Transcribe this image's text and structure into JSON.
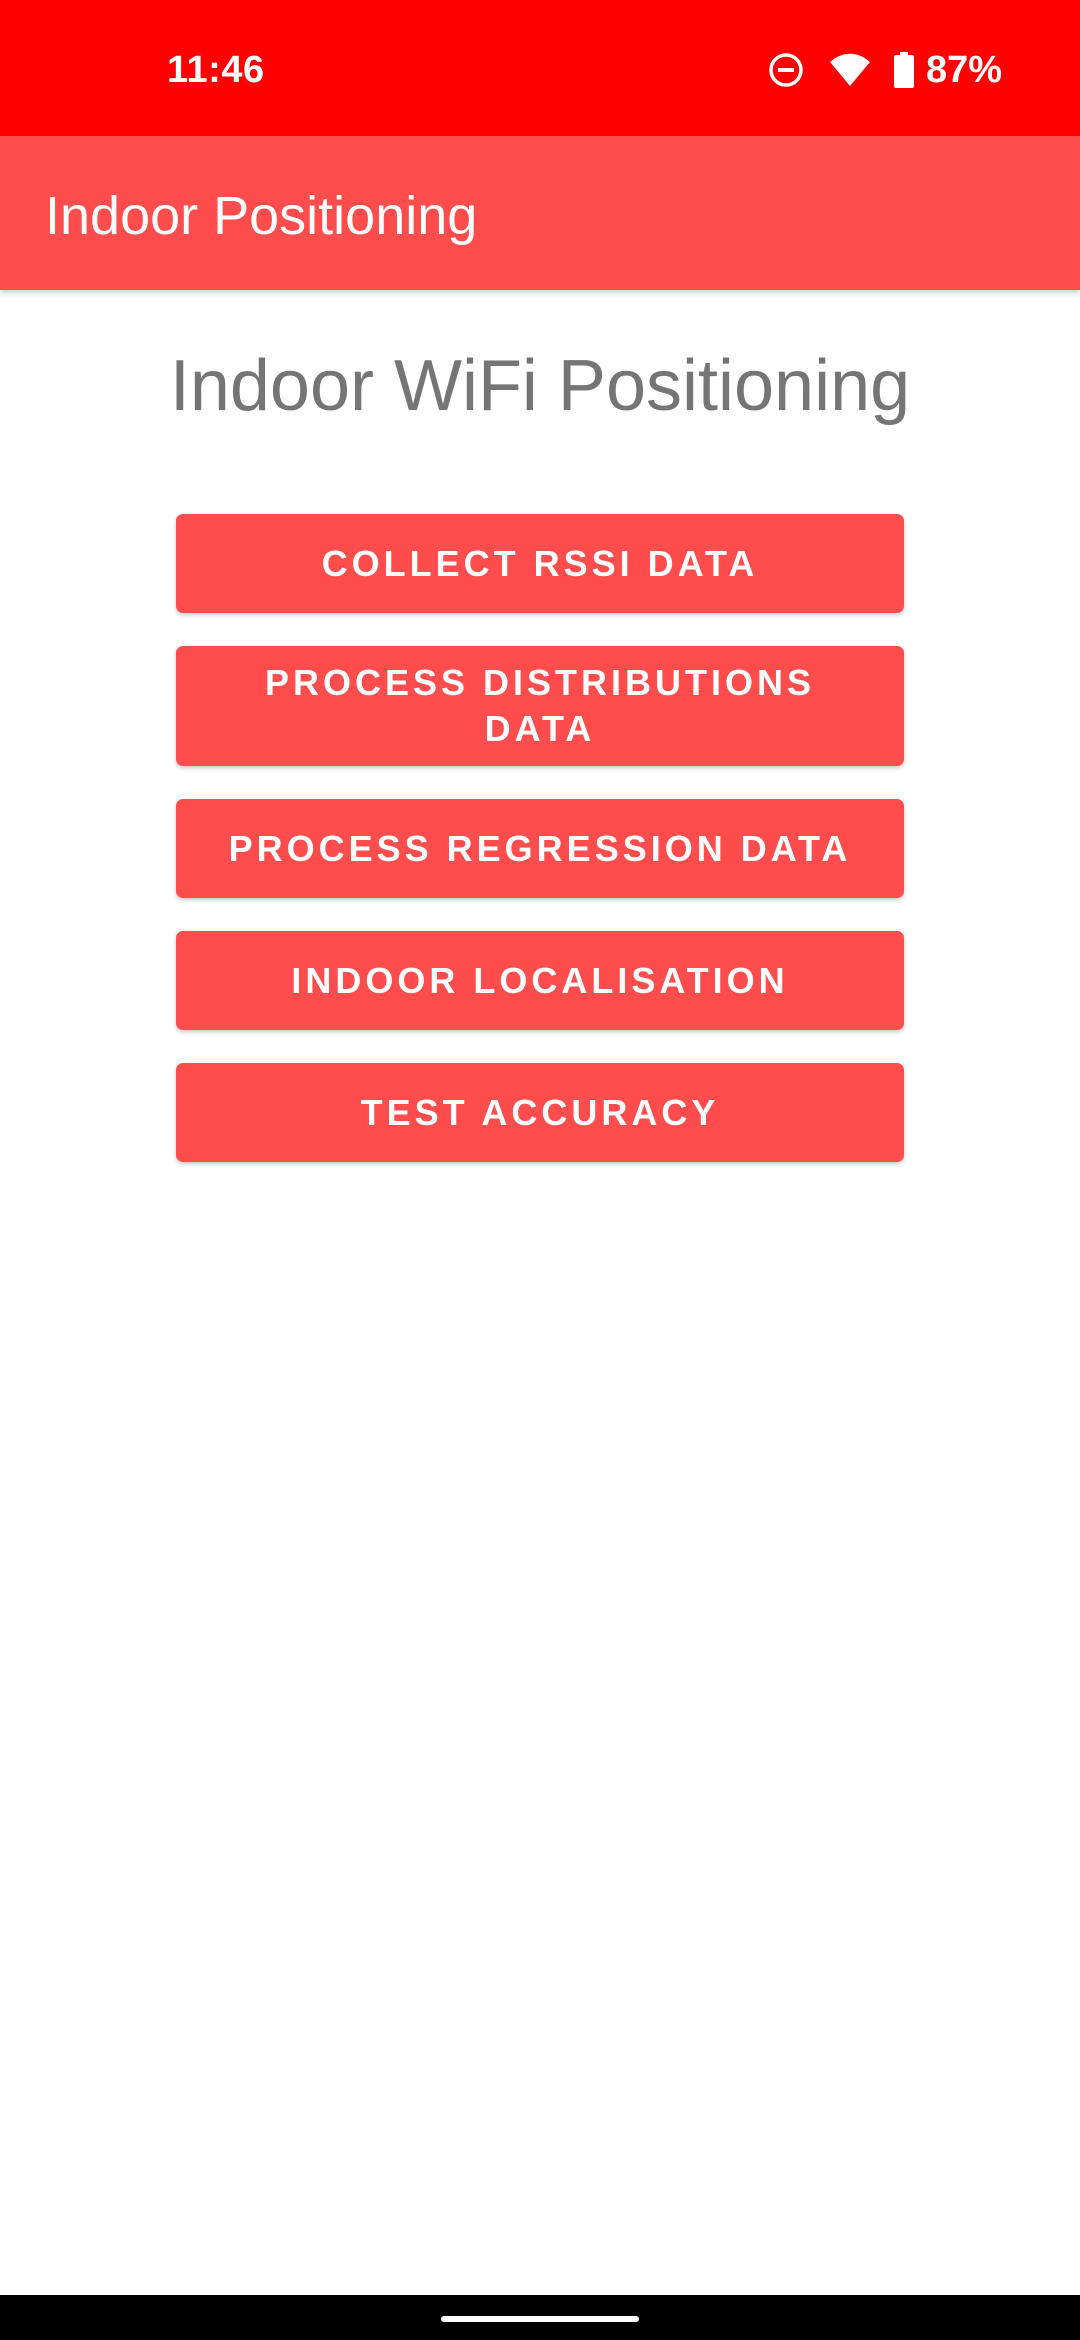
{
  "status_bar": {
    "time": "11:46",
    "battery_percent": "87%",
    "icons": [
      "do-not-disturb-icon",
      "wifi-icon",
      "battery-icon"
    ],
    "background_color": "#ff0000"
  },
  "app_bar": {
    "title": "Indoor Positioning",
    "background_color": "#ff4c4c"
  },
  "main": {
    "heading": "Indoor WiFi Positioning",
    "buttons": [
      {
        "label": "COLLECT RSSI DATA"
      },
      {
        "label": "PROCESS DISTRIBUTIONS DATA"
      },
      {
        "label": "PROCESS REGRESSION DATA"
      },
      {
        "label": "INDOOR LOCALISATION"
      },
      {
        "label": "TEST ACCURACY"
      }
    ]
  },
  "colors": {
    "accent": "#ff4c4c",
    "heading_text": "#757575"
  }
}
